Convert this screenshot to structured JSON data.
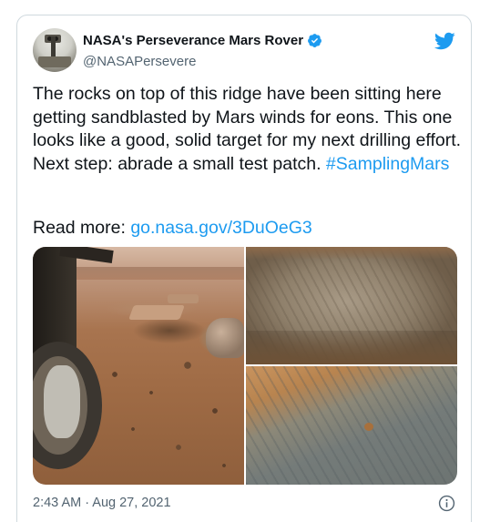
{
  "tweet": {
    "author": {
      "display_name": "NASA's Perseverance Mars Rover",
      "handle": "@NASAPersevere",
      "verified": true,
      "avatar_icon": "rover-avatar"
    },
    "text": "The rocks on top of this ridge have been sitting here getting sandblasted by Mars winds for eons. This one looks like a good, solid target for my next drilling effort. Next step: abrade a small test patch.",
    "hashtag": "#SamplingMars",
    "read_more_label": "Read more:",
    "link_text": "go.nasa.gov/3DuOeG3",
    "timestamp": "2:43 AM · Aug 27, 2021",
    "media_count": 3
  },
  "icons": {
    "verified": "verified-badge-icon",
    "brand": "twitter-bird-icon",
    "info": "info-icon"
  },
  "colors": {
    "accent": "#1d9bf0",
    "text": "#0f1419",
    "secondary_text": "#536471",
    "border": "#cfd9de"
  }
}
